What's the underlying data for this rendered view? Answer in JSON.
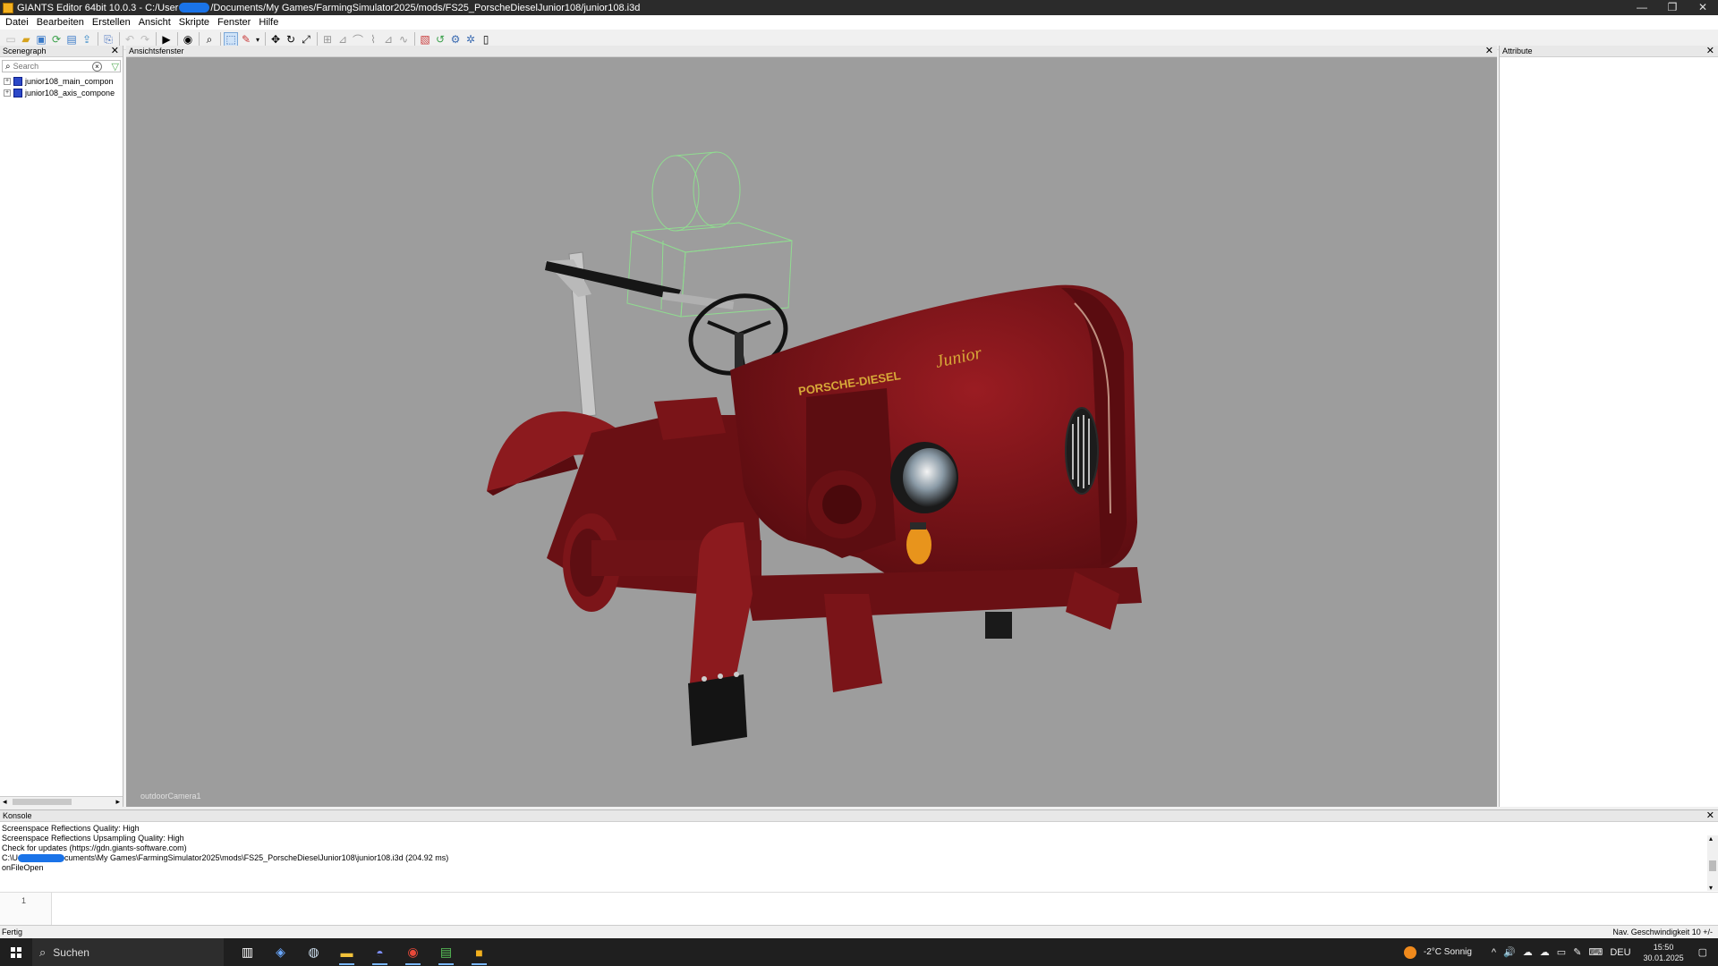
{
  "window": {
    "title_prefix": "GIANTS Editor 64bit 10.0.3 - C:/User",
    "title_suffix": "/Documents/My Games/FarmingSimulator2025/mods/FS25_PorscheDieselJunior108/junior108.i3d",
    "controls": {
      "minimize": "—",
      "restore": "❐",
      "close": "✕"
    }
  },
  "menu": [
    "Datei",
    "Bearbeiten",
    "Erstellen",
    "Ansicht",
    "Skripte",
    "Fenster",
    "Hilfe"
  ],
  "toolbar_icons": [
    "new-icon",
    "open-icon",
    "save-icon",
    "reload-icon",
    "save-all-icon",
    "export-icon",
    "import-icon",
    "undo-icon",
    "redo-icon",
    "play-icon",
    "visibility-icon",
    "zoom-icon",
    "select-icon",
    "paint-icon",
    "dropdown-icon",
    "move-icon",
    "rotate-icon",
    "scale-icon",
    "align-icon",
    "snap-icon",
    "terrain-icon",
    "foliage-icon",
    "decal-icon",
    "spline-icon",
    "material-icon",
    "refresh-icon",
    "settings-icon",
    "build-icon",
    "clipboard-icon"
  ],
  "scenegraph": {
    "title": "Scenegraph",
    "search_placeholder": "Search",
    "items": [
      {
        "label": "junior108_main_compon"
      },
      {
        "label": "junior108_axis_compone"
      }
    ]
  },
  "viewport": {
    "title": "Ansichtsfenster",
    "camera": "outdoorCamera1",
    "decal_text": "PORSCHE-DIESEL",
    "logo_text": "Junior"
  },
  "attributes": {
    "title": "Attribute"
  },
  "console": {
    "title": "Konsole",
    "lines": [
      " Screenspace Reflections Quality: High",
      " Screenspace Reflections Upsampling Quality: High",
      "Check for updates (https://gdn.giants-software.com)"
    ],
    "path_prefix": "C:\\U",
    "path_suffix": "cuments\\My Games\\FarmingSimulator2025\\mods\\FS25_PorscheDieselJunior108\\junior108.i3d (204.92 ms)",
    "last_line": "onFileOpen",
    "line_number": "1"
  },
  "status": {
    "left": "Fertig",
    "right": "Nav. Geschwindigkeit 10 +/-"
  },
  "taskbar": {
    "search": "Suchen",
    "apps": [
      "task-view-icon",
      "copilot-icon",
      "steam-icon",
      "explorer-icon",
      "discord-icon",
      "chrome-icon",
      "notepad-icon",
      "giants-editor-icon"
    ],
    "weather": "-2°C  Sonnig",
    "lang": "DEU",
    "time": "15:50",
    "date": "30.01.2025"
  },
  "colors": {
    "tractor_red": "#7e1418",
    "viewport_bg": "#9d9d9d",
    "selection_wire": "#8fe38f"
  }
}
